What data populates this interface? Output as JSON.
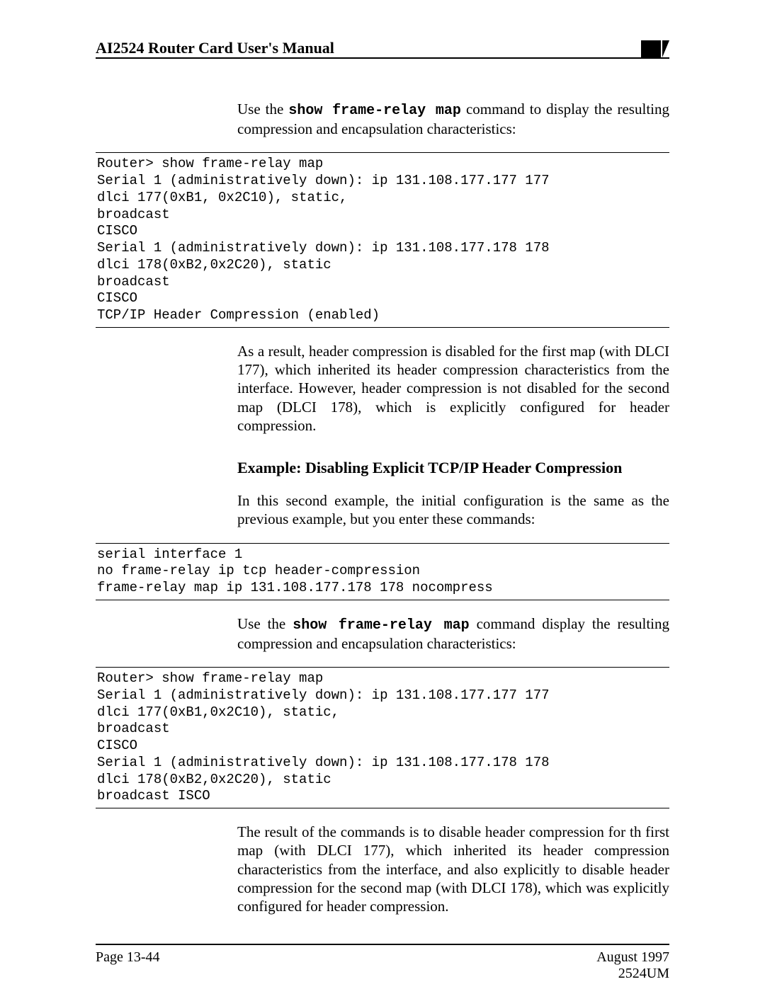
{
  "header": {
    "title": "AI2524 Router Card User's Manual"
  },
  "p1": {
    "pre": "Use the ",
    "cmd": "show frame-relay map",
    "post": " command to display the resulting compression and encapsulation characteristics:"
  },
  "terminal1": "Router> show frame-relay map\nSerial 1 (administratively down): ip 131.108.177.177 177\ndlci 177(0xB1, 0x2C10), static,\nbroadcast\nCISCO\nSerial 1 (administratively down): ip 131.108.177.178 178\ndlci 178(0xB2,0x2C20), static\nbroadcast\nCISCO\nTCP/IP Header Compression (enabled)",
  "p2": "As a result, header compression is disabled for the first map (with DLCI 177), which inherited its header compression characteristics from the interface. However, header compression is not disabled for the second map (DLCI 178), which is explicitly configured for header compression.",
  "example_heading": "Example: Disabling Explicit TCP/IP Header Compression",
  "p3": "In this second example, the initial configuration is the same as the previous example, but you enter these commands:",
  "terminal2": "serial interface 1\nno frame-relay ip tcp header-compression\nframe-relay map ip 131.108.177.178 178 nocompress",
  "p4": {
    "pre": "Use the ",
    "cmd": "show frame-relay map",
    "post": " command display the resulting compression and encapsulation characteristics:"
  },
  "terminal3": "Router> show frame-relay map\nSerial 1 (administratively down): ip 131.108.177.177 177\ndlci 177(0xB1,0x2C10), static,\nbroadcast\nCISCO\nSerial 1 (administratively down): ip 131.108.177.178 178\ndlci 178(0xB2,0x2C20), static\nbroadcast ISCO",
  "p5": "The result of the commands is to disable header compression for th first map (with DLCI 177), which inherited its header compression characteristics from the interface, and also explicitly to disable header compression for the second map (with DLCI 178), which was explicitly configured for header compression.",
  "footer": {
    "page": "Page 13-44",
    "date": "August 1997",
    "doc": "2524UM"
  }
}
